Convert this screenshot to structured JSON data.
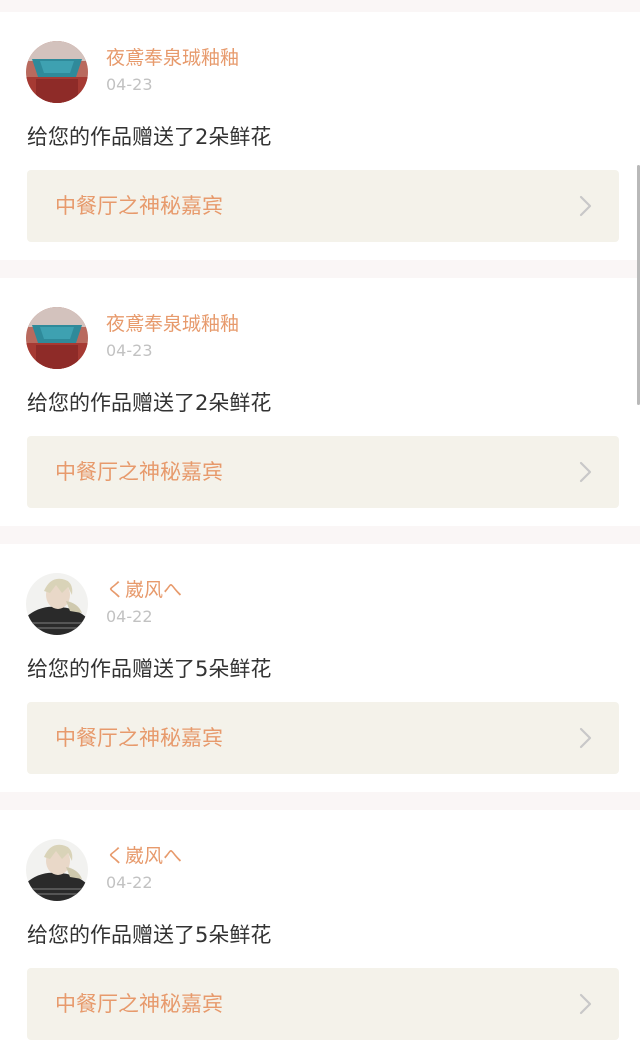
{
  "notifications": [
    {
      "username": "夜鳶奉泉珹釉釉",
      "date": "04-23",
      "message": "给您的作品赠送了2朵鲜花",
      "work_title": "中餐厅之神秘嘉宾",
      "avatar": "avatar-red-blue"
    },
    {
      "username": "夜鳶奉泉珹釉釉",
      "date": "04-23",
      "message": "给您的作品赠送了2朵鲜花",
      "work_title": "中餐厅之神秘嘉宾",
      "avatar": "avatar-red-blue"
    },
    {
      "username": "く崴风へ",
      "date": "04-22",
      "message": "给您的作品赠送了5朵鲜花",
      "work_title": "中餐厅之神秘嘉宾",
      "avatar": "avatar-anime-character"
    },
    {
      "username": "く崴风へ",
      "date": "04-22",
      "message": "给您的作品赠送了5朵鲜花",
      "work_title": "中餐厅之神秘嘉宾",
      "avatar": "avatar-anime-character"
    }
  ],
  "colors": {
    "accent": "#e79a6c",
    "date_gray": "#c2c2c2",
    "text": "#333333",
    "link_bg": "#f4f2ea",
    "page_bg": "#faf6f6"
  },
  "icons": {
    "chevron": "chevron-right-icon"
  }
}
